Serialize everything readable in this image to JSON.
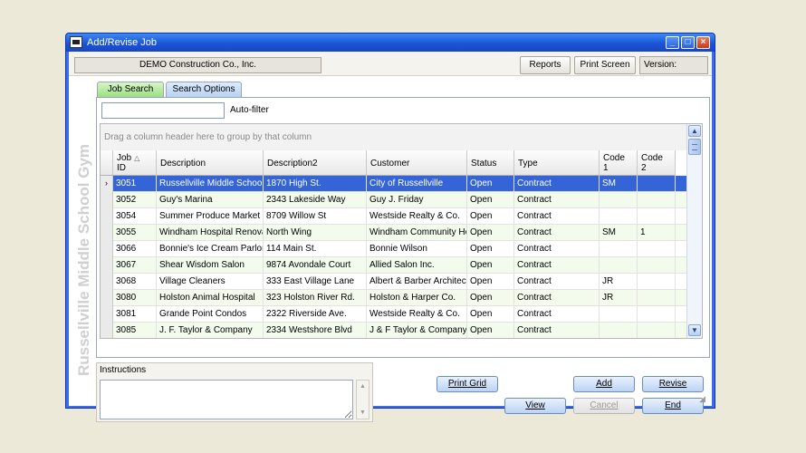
{
  "window": {
    "title": "Add/Revise Job"
  },
  "topbar": {
    "company": "DEMO Construction Co., Inc.",
    "reports_label": "Reports",
    "print_screen_label": "Print Screen",
    "version_label": "Version:"
  },
  "side_label": "Russellville Middle School Gym",
  "tabs": [
    {
      "label": "Job Search",
      "active": true
    },
    {
      "label": "Search Options",
      "active": false
    }
  ],
  "filter": {
    "value": "",
    "label": "Auto-filter"
  },
  "grid": {
    "group_hint": "Drag a column header here to group by that column",
    "columns": [
      {
        "label": "Job\nID",
        "sort": "ascending"
      },
      {
        "label": "Description"
      },
      {
        "label": "Description2"
      },
      {
        "label": "Customer"
      },
      {
        "label": "Status"
      },
      {
        "label": "Type"
      },
      {
        "label": "Code\n1"
      },
      {
        "label": "Code\n2"
      }
    ],
    "selected_row": 0,
    "rows": [
      [
        "3051",
        "Russellville Middle School Gym",
        "1870 High St.",
        "City of Russellville",
        "Open",
        "Contract",
        "SM",
        ""
      ],
      [
        "3052",
        "Guy's Marina",
        "2343 Lakeside Way",
        "Guy J. Friday",
        "Open",
        "Contract",
        "",
        ""
      ],
      [
        "3054",
        "Summer Produce Market",
        "8709 Willow St",
        "Westside Realty & Co.",
        "Open",
        "Contract",
        "",
        ""
      ],
      [
        "3055",
        "Windham Hospital Renovation",
        "North Wing",
        "Windham Community Hospital",
        "Open",
        "Contract",
        "SM",
        "1"
      ],
      [
        "3066",
        "Bonnie's Ice Cream Parlor",
        "114 Main St.",
        "Bonnie Wilson",
        "Open",
        "Contract",
        "",
        ""
      ],
      [
        "3067",
        "Shear Wisdom Salon",
        "9874 Avondale Court",
        "Allied Salon Inc.",
        "Open",
        "Contract",
        "",
        ""
      ],
      [
        "3068",
        "Village Cleaners",
        "333 East Village Lane",
        "Albert & Barber Architects",
        "Open",
        "Contract",
        "JR",
        ""
      ],
      [
        "3080",
        "Holston Animal Hospital",
        "323 Holston River Rd.",
        "Holston & Harper Co.",
        "Open",
        "Contract",
        "JR",
        ""
      ],
      [
        "3081",
        "Grande Point Condos",
        "2322 Riverside Ave.",
        "Westside Realty & Co.",
        "Open",
        "Contract",
        "",
        ""
      ],
      [
        "3085",
        "J. F. Taylor & Company",
        "2334 Westshore Blvd",
        "J & F Taylor & Company",
        "Open",
        "Contract",
        "",
        ""
      ]
    ]
  },
  "instructions": {
    "label": "Instructions",
    "value": ""
  },
  "buttons": {
    "print_grid": "Print Grid",
    "add": "Add",
    "revise": "Revise",
    "view": "View",
    "cancel": "Cancel",
    "end": "End"
  }
}
